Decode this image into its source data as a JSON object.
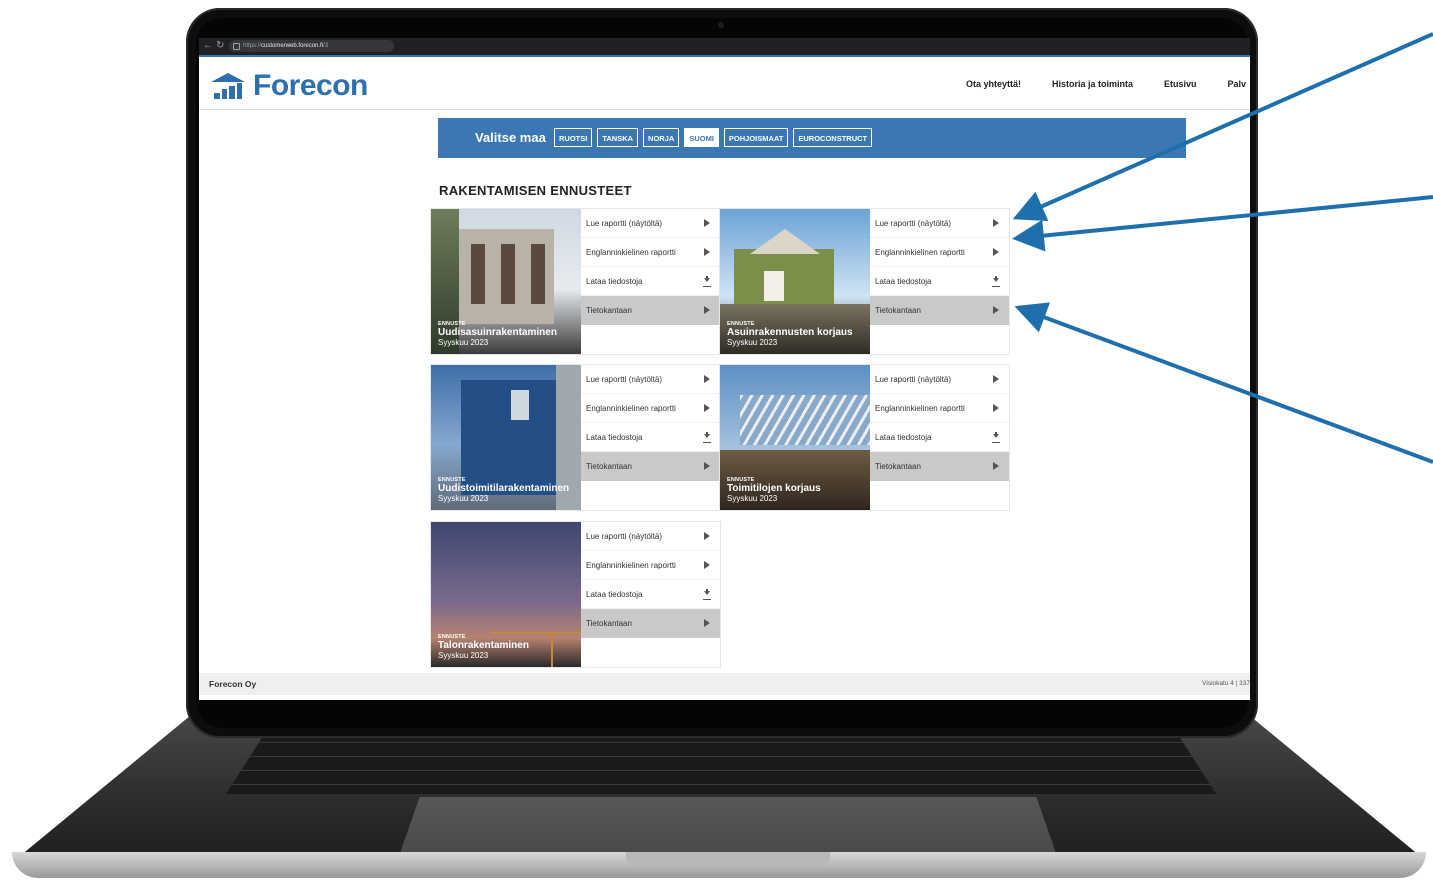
{
  "browser": {
    "url_prefix": "https://",
    "url_host": "customerweb.forecon.fi",
    "url_suffix": "/3"
  },
  "header": {
    "logo_text": "Forecon",
    "nav": [
      "Ota yhteyttä!",
      "Historia ja toiminta",
      "Etusivu",
      "Palv"
    ]
  },
  "country_selector": {
    "label": "Valitse maa",
    "options": [
      "RUOTSI",
      "TANSKA",
      "NORJA",
      "SUOMI",
      "POHJOISMAAT",
      "EUROCONSTRUCT"
    ],
    "selected": "SUOMI"
  },
  "section_title": "RAKENTAMISEN ENNUSTEET",
  "cards": [
    {
      "tag": "ENNUSTE",
      "title": "Uudisasuinrakentaminen",
      "date": "Syyskuu 2023"
    },
    {
      "tag": "ENNUSTE",
      "title": "Asuinrakennusten korjaus",
      "date": "Syyskuu 2023"
    },
    {
      "tag": "ENNUSTE",
      "title": "Uudistoimitilarakentaminen",
      "date": "Syyskuu 2023"
    },
    {
      "tag": "ENNUSTE",
      "title": "Toimitilojen korjaus",
      "date": "Syyskuu 2023"
    },
    {
      "tag": "ENNUSTE",
      "title": "Talonrakentaminen",
      "date": "Syyskuu 2023"
    }
  ],
  "card_links": {
    "read_report": "Lue raportti (näytöltä)",
    "english_report": "Englanninkielinen raportti",
    "download_files": "Lataa tiedostoja",
    "database": "Tietokantaan"
  },
  "footer": {
    "company": "Forecon Oy",
    "address": "Visiokatu 4 | 337"
  },
  "colors": {
    "brand_blue": "#3b78b3",
    "annotation_arrow": "#1f6fad"
  }
}
